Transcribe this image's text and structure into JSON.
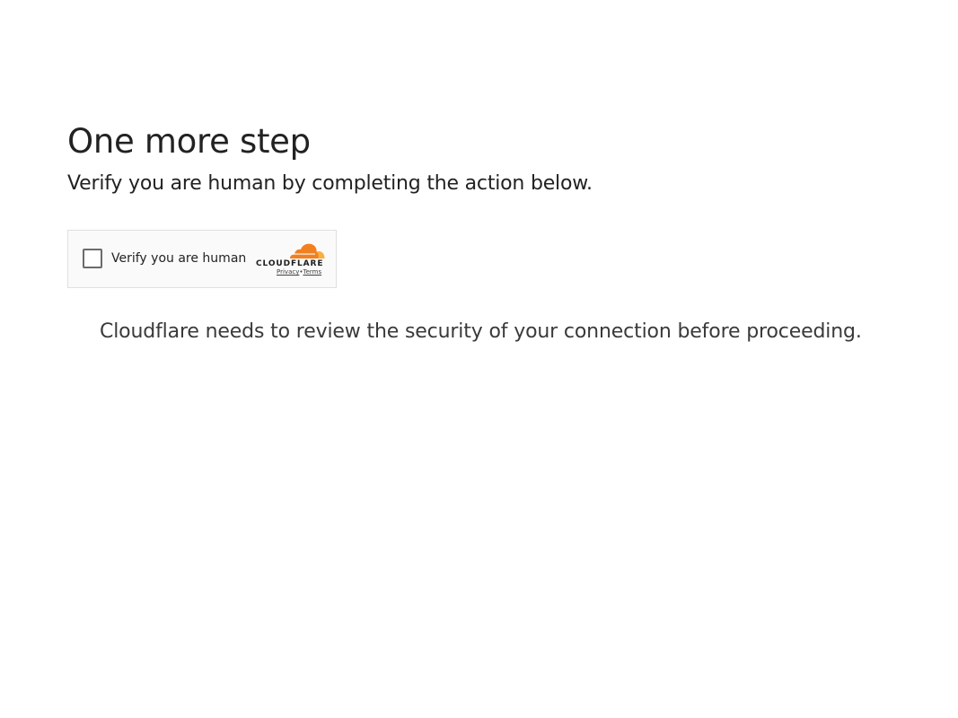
{
  "heading": {
    "title": "One more step",
    "subtitle": "Verify you are human by completing the action below."
  },
  "challenge_widget": {
    "checkbox_label": "Verify you are human",
    "checked": false,
    "brand_wordmark": "CLOUDFLARE",
    "privacy_link": "Privacy",
    "separator": "•",
    "terms_link": "Terms",
    "brand_color": "#f38020",
    "brand_color_light": "#faae40"
  },
  "message": "Cloudflare needs to review the security of your connection before proceeding."
}
